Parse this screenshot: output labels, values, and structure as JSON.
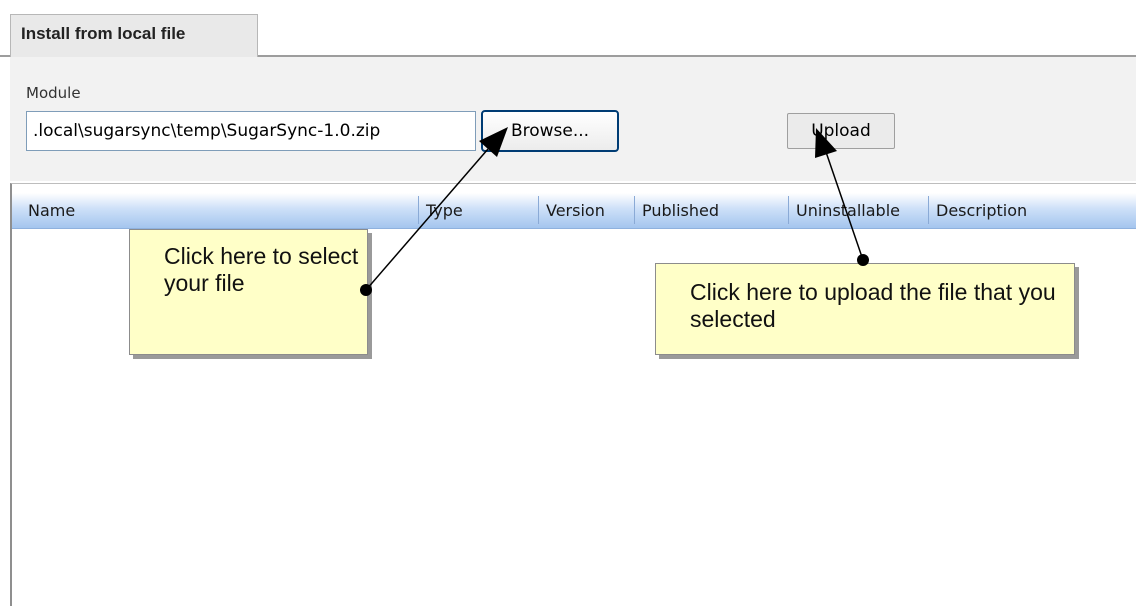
{
  "tab": {
    "label": "Install from local file"
  },
  "module": {
    "label": "Module",
    "file_value": ".local\\sugarsync\\temp\\SugarSync-1.0.zip",
    "browse_label": "Browse...",
    "upload_label": "Upload"
  },
  "table": {
    "columns": [
      "Name",
      "Type",
      "Version",
      "Published",
      "Uninstallable",
      "Description"
    ],
    "rows": []
  },
  "annotations": {
    "select_file": "Click here to select your file",
    "upload_file": "Click here to upload the file that you selected"
  },
  "colors": {
    "header_gradient_top": "#ffffff",
    "header_gradient_bottom": "#a4c5ee",
    "callout_background": "#ffffc8",
    "toolbar_background": "#f2f2f2"
  }
}
